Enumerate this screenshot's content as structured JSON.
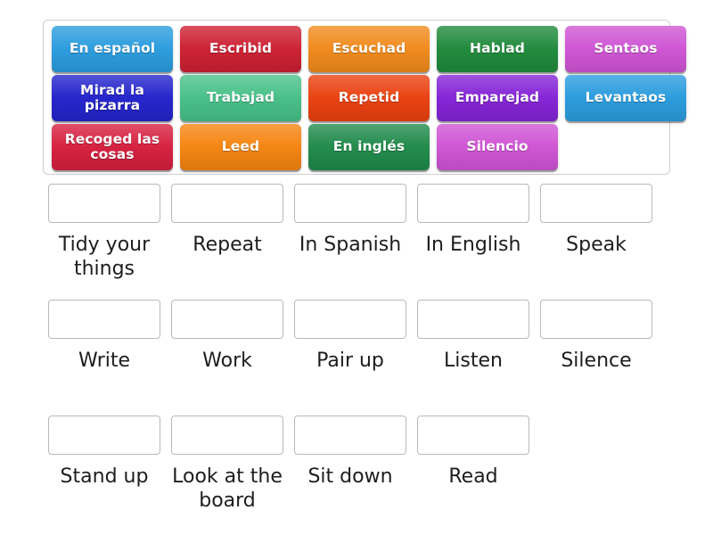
{
  "activity": {
    "type": "match-up-drag-and-drop",
    "title": "Classroom instructions Spanish to English match up"
  },
  "tile_bank": {
    "name": "draggable-tiles",
    "rows": [
      [
        {
          "label": "En español",
          "color": "#2a9cde",
          "name": "tile-en-espanol"
        },
        {
          "label": "Escribid",
          "color": "#cd2032",
          "name": "tile-escribid"
        },
        {
          "label": "Escuchad",
          "color": "#f18a1c",
          "name": "tile-escuchad"
        },
        {
          "label": "Hablad",
          "color": "#1f8a3b",
          "name": "tile-hablad"
        },
        {
          "label": "Sentaos",
          "color": "#cf54d4",
          "name": "tile-sentaos"
        }
      ],
      [
        {
          "label": "Mirad la pizarra",
          "color": "#2323cc",
          "name": "tile-mirad-la-pizarra"
        },
        {
          "label": "Trabajad",
          "color": "#47c088",
          "name": "tile-trabajad"
        },
        {
          "label": "Repetid",
          "color": "#ea400f",
          "name": "tile-repetid"
        },
        {
          "label": "Emparejad",
          "color": "#8423d6",
          "name": "tile-emparejad"
        },
        {
          "label": "Levantaos",
          "color": "#2a9cde",
          "name": "tile-levantaos"
        }
      ],
      [
        {
          "label": "Recoged las cosas",
          "color": "#d61f3f",
          "name": "tile-recoged-las-cosas"
        },
        {
          "label": "Leed",
          "color": "#f58410",
          "name": "tile-leed"
        },
        {
          "label": "En inglés",
          "color": "#1f8a4a",
          "name": "tile-en-ingles"
        },
        {
          "label": "Silencio",
          "color": "#cf54d4",
          "name": "tile-silencio"
        },
        {
          "label": "",
          "color": "transparent",
          "name": "tile-slot-empty"
        }
      ]
    ]
  },
  "answers": {
    "name": "answer-drop-zones",
    "rows": [
      [
        {
          "label": "Tidy your things",
          "value": "",
          "name": "drop-tidy-your-things"
        },
        {
          "label": "Repeat",
          "value": "",
          "name": "drop-repeat"
        },
        {
          "label": "In Spanish",
          "value": "",
          "name": "drop-in-spanish"
        },
        {
          "label": "In English",
          "value": "",
          "name": "drop-in-english"
        },
        {
          "label": "Speak",
          "value": "",
          "name": "drop-speak"
        }
      ],
      [
        {
          "label": "Write",
          "value": "",
          "name": "drop-write"
        },
        {
          "label": "Work",
          "value": "",
          "name": "drop-work"
        },
        {
          "label": "Pair up",
          "value": "",
          "name": "drop-pair-up"
        },
        {
          "label": "Listen",
          "value": "",
          "name": "drop-listen"
        },
        {
          "label": "Silence",
          "value": "",
          "name": "drop-silence"
        }
      ],
      [
        {
          "label": "Stand up",
          "value": "",
          "name": "drop-stand-up"
        },
        {
          "label": "Look at the board",
          "value": "",
          "name": "drop-look-at-the-board"
        },
        {
          "label": "Sit down",
          "value": "",
          "name": "drop-sit-down"
        },
        {
          "label": "Read",
          "value": "",
          "name": "drop-read"
        }
      ]
    ]
  },
  "colors": {
    "container_border": "#cfcfcf",
    "drop_border": "#b9b9b9",
    "page_background": "#ffffff",
    "label_text": "#1d1d1d",
    "tile_text": "#ffffff"
  }
}
